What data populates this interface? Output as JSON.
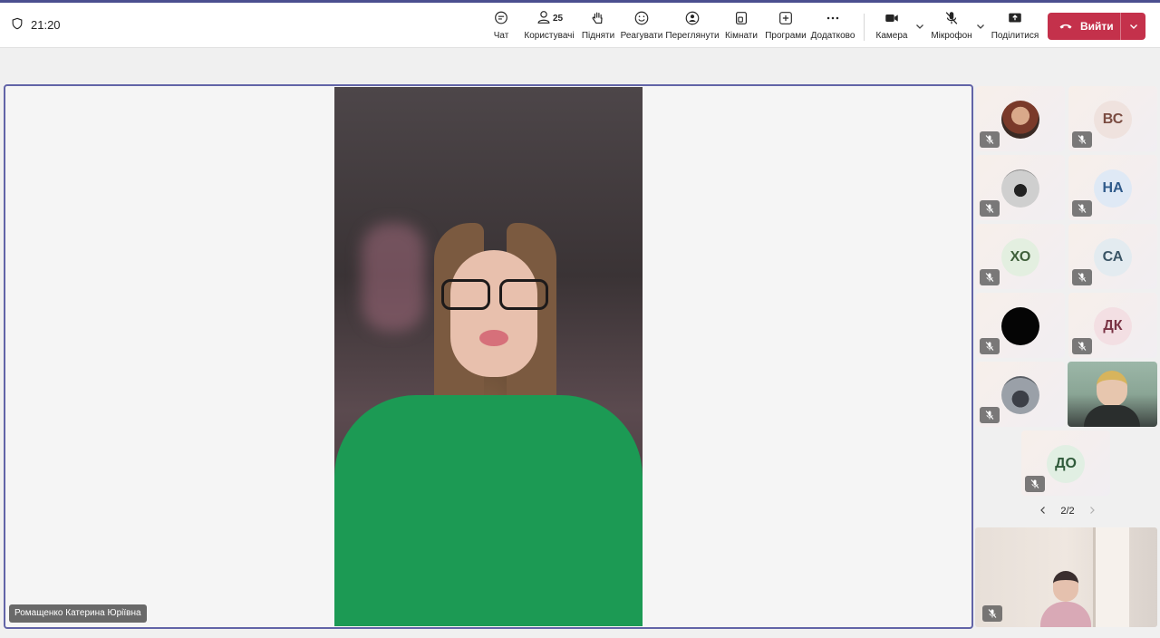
{
  "meeting": {
    "elapsed_time": "21:20"
  },
  "toolbar": {
    "chat_label": "Чат",
    "people_label": "Користувачі",
    "people_count": "25",
    "raise_label": "Підняти",
    "react_label": "Реагувати",
    "view_label": "Переглянути",
    "rooms_label": "Кімнати",
    "apps_label": "Програми",
    "more_label": "Додатково",
    "camera_label": "Камера",
    "mic_label": "Мікрофон",
    "share_label": "Поділитися",
    "leave_label": "Вийти"
  },
  "stage": {
    "speaker_name": "Ромащенко Катерина Юріївна"
  },
  "participants": [
    {
      "initials": "",
      "kind": "photo"
    },
    {
      "initials": "ВС",
      "kind": "initials"
    },
    {
      "initials": "",
      "kind": "photo"
    },
    {
      "initials": "НА",
      "kind": "initials"
    },
    {
      "initials": "ХО",
      "kind": "initials"
    },
    {
      "initials": "СА",
      "kind": "initials"
    },
    {
      "initials": "",
      "kind": "photo"
    },
    {
      "initials": "ДК",
      "kind": "initials"
    },
    {
      "initials": "",
      "kind": "photo"
    },
    {
      "initials": "",
      "kind": "video"
    },
    {
      "initials": "ДО",
      "kind": "initials"
    }
  ],
  "pager": {
    "label": "2/2"
  },
  "colors": {
    "accent": "#6264a7",
    "leave": "#c4314b"
  }
}
